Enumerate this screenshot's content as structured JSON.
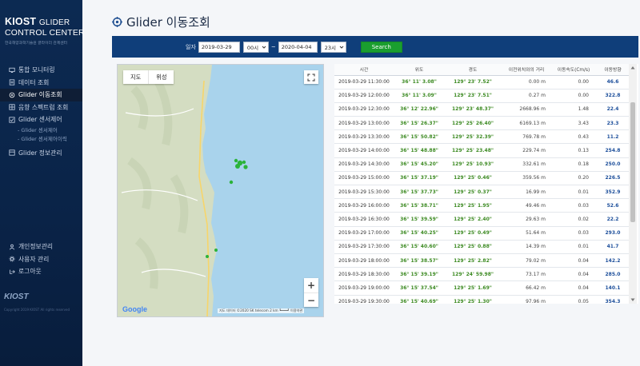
{
  "sidebar": {
    "logo_main": "KIOST",
    "logo_glider": "GLIDER",
    "logo_line2": "CONTROL CENTER",
    "logo_sub": "한국해양과학기술원 글라이더 관제센터",
    "menu": [
      {
        "label": "통합 모니터링",
        "icon": "monitor-icon"
      },
      {
        "label": "데이터 조회",
        "icon": "data-icon"
      },
      {
        "label": "Glider 이동조회",
        "icon": "target-icon",
        "active": true
      },
      {
        "label": "음향 스펙트럼 조회",
        "icon": "grid-icon"
      },
      {
        "label": "Glider 센서제어",
        "icon": "checkbox-icon"
      }
    ],
    "submenu": [
      "- Glider 센서제어",
      "- Glider 센서제어이력"
    ],
    "menu_after": [
      {
        "label": "Glider 정보관리",
        "icon": "box-icon"
      }
    ],
    "bottom_menu": [
      {
        "label": "개인정보관리",
        "icon": "person-icon"
      },
      {
        "label": "사용자 관리",
        "icon": "gear-icon"
      },
      {
        "label": "로그아웃",
        "icon": "logout-icon"
      }
    ],
    "footer_logo": "KIOST",
    "copyright": "Copyright 2019 KIOST All rights reserved"
  },
  "header": {
    "title": "Glider 이동조회"
  },
  "filter": {
    "label": "일자",
    "start_date": "2019-03-29",
    "start_hour": "00시",
    "separator": "~",
    "end_date": "2020-04-04",
    "end_hour": "23시",
    "search_label": "Search"
  },
  "map": {
    "tab_map": "지도",
    "tab_satellite": "위성",
    "zoom_in": "+",
    "zoom_out": "−",
    "google": "Google",
    "attribution": "지도 데이터 ©2020 SK telecom   2 km ┗━━━┛   이용약관",
    "colors": {
      "sea": "#a9d3ec",
      "land": "#d2dcc0",
      "marker": "#2bb33a"
    }
  },
  "table": {
    "headers": [
      "시간",
      "위도",
      "경도",
      "이전위치와의 거리",
      "이동속도(Cm/s)",
      "이동방향"
    ],
    "rows": [
      {
        "time": "2019-03-29 11:30:00",
        "lat": "36° 11' 3.08\"",
        "lon": "129° 23' 7.52\"",
        "dist": "0.00 m",
        "speed": "0.00",
        "dir": "46.6"
      },
      {
        "time": "2019-03-29 12:00:00",
        "lat": "36° 11' 3.09\"",
        "lon": "129° 23' 7.51\"",
        "dist": "0.27 m",
        "speed": "0.00",
        "dir": "322.8"
      },
      {
        "time": "2019-03-29 12:30:00",
        "lat": "36° 12' 22.96\"",
        "lon": "129° 23' 48.37\"",
        "dist": "2668.96 m",
        "speed": "1.48",
        "dir": "22.4"
      },
      {
        "time": "2019-03-29 13:00:00",
        "lat": "36° 15' 26.37\"",
        "lon": "129° 25' 26.40\"",
        "dist": "6169.13 m",
        "speed": "3.43",
        "dir": "23.3"
      },
      {
        "time": "2019-03-29 13:30:00",
        "lat": "36° 15' 50.82\"",
        "lon": "129° 25' 32.39\"",
        "dist": "769.78 m",
        "speed": "0.43",
        "dir": "11.2"
      },
      {
        "time": "2019-03-29 14:00:00",
        "lat": "36° 15' 48.88\"",
        "lon": "129° 25' 23.48\"",
        "dist": "229.74 m",
        "speed": "0.13",
        "dir": "254.8"
      },
      {
        "time": "2019-03-29 14:30:00",
        "lat": "36° 15' 45.20\"",
        "lon": "129° 25' 10.93\"",
        "dist": "332.61 m",
        "speed": "0.18",
        "dir": "250.0"
      },
      {
        "time": "2019-03-29 15:00:00",
        "lat": "36° 15' 37.19\"",
        "lon": "129° 25' 0.46\"",
        "dist": "359.56 m",
        "speed": "0.20",
        "dir": "226.5"
      },
      {
        "time": "2019-03-29 15:30:00",
        "lat": "36° 15' 37.73\"",
        "lon": "129° 25' 0.37\"",
        "dist": "16.99 m",
        "speed": "0.01",
        "dir": "352.9"
      },
      {
        "time": "2019-03-29 16:00:00",
        "lat": "36° 15' 38.71\"",
        "lon": "129° 25' 1.95\"",
        "dist": "49.46 m",
        "speed": "0.03",
        "dir": "52.6"
      },
      {
        "time": "2019-03-29 16:30:00",
        "lat": "36° 15' 39.59\"",
        "lon": "129° 25' 2.40\"",
        "dist": "29.63 m",
        "speed": "0.02",
        "dir": "22.2"
      },
      {
        "time": "2019-03-29 17:00:00",
        "lat": "36° 15' 40.25\"",
        "lon": "129° 25' 0.49\"",
        "dist": "51.64 m",
        "speed": "0.03",
        "dir": "293.0"
      },
      {
        "time": "2019-03-29 17:30:00",
        "lat": "36° 15' 40.60\"",
        "lon": "129° 25' 0.88\"",
        "dist": "14.39 m",
        "speed": "0.01",
        "dir": "41.7"
      },
      {
        "time": "2019-03-29 18:00:00",
        "lat": "36° 15' 38.57\"",
        "lon": "129° 25' 2.82\"",
        "dist": "79.02 m",
        "speed": "0.04",
        "dir": "142.2"
      },
      {
        "time": "2019-03-29 18:30:00",
        "lat": "36° 15' 39.19\"",
        "lon": "129° 24' 59.98\"",
        "dist": "73.17 m",
        "speed": "0.04",
        "dir": "285.0"
      },
      {
        "time": "2019-03-29 19:00:00",
        "lat": "36° 15' 37.54\"",
        "lon": "129° 25' 1.69\"",
        "dist": "66.42 m",
        "speed": "0.04",
        "dir": "140.1"
      },
      {
        "time": "2019-03-29 19:30:00",
        "lat": "36° 15' 40.69\"",
        "lon": "129° 25' 1.30\"",
        "dist": "97.96 m",
        "speed": "0.05",
        "dir": "354.3"
      }
    ]
  }
}
